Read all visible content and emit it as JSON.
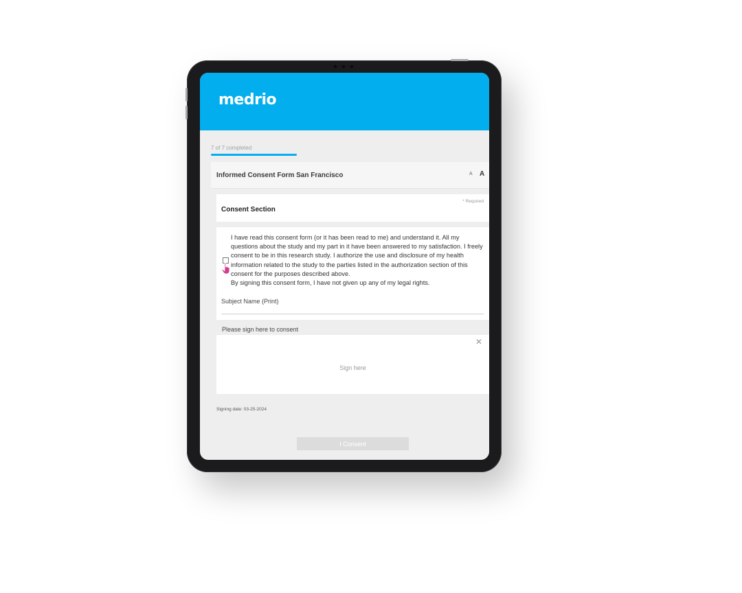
{
  "app": {
    "brand": "medrio",
    "brand_color": "#02aeed"
  },
  "progress": {
    "label": "7 of 7 completed",
    "fraction": 1.0
  },
  "form": {
    "title": "Informed Consent Form San Francisco",
    "font_small_label": "A",
    "font_large_label": "A"
  },
  "section": {
    "title": "Consent Section",
    "required_label": "* Required"
  },
  "consent": {
    "checked": false,
    "paragraph_1": "I have read this consent form (or it has been read to me) and understand it. All my questions about the study and my part in it have been answered to my satisfaction. I freely consent to be in this research study. I authorize the use and disclosure of my health information related to the study to the parties listed in the authorization section of this consent for the purposes described above.",
    "paragraph_2": "By signing this consent form, I have not given up any of my legal rights.",
    "subject_name_label": "Subject Name (Print)",
    "subject_name_value": ""
  },
  "signature": {
    "label": "Please sign here to consent",
    "placeholder": "Sign here",
    "clear_icon": "close-icon"
  },
  "signing_date": "Signing date: 03-25-2024",
  "consent_button": {
    "label": "I Consent",
    "enabled": false
  },
  "icons": {
    "cursor": "hand-pointer-icon"
  }
}
